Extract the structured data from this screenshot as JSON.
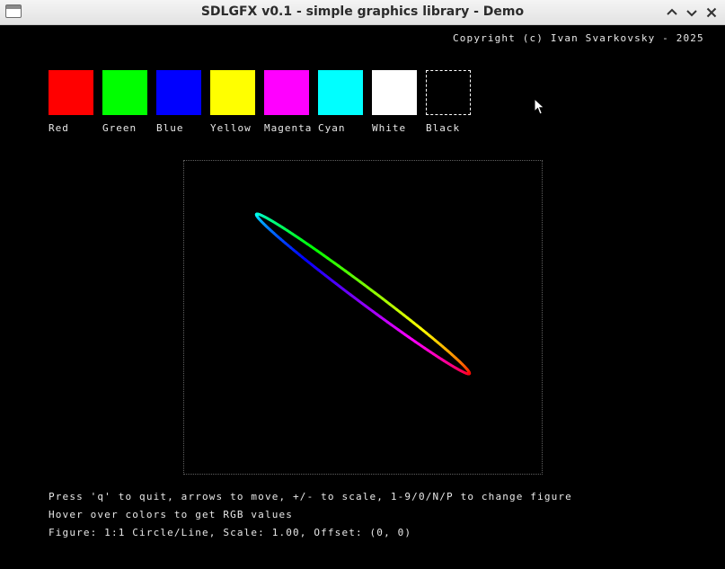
{
  "window": {
    "title": "SDLGFX v0.1 - simple graphics library - Demo",
    "buttons": [
      "minimize-icon",
      "maximize-icon",
      "close-icon"
    ]
  },
  "copyright": "Copyright (c) Ivan Svarkovsky - 2025",
  "palette": [
    {
      "label": "Red",
      "color": "#ff0000"
    },
    {
      "label": "Green",
      "color": "#00ff00"
    },
    {
      "label": "Blue",
      "color": "#0000ff"
    },
    {
      "label": "Yellow",
      "color": "#ffff00"
    },
    {
      "label": "Magenta",
      "color": "#ff00ff"
    },
    {
      "label": "Cyan",
      "color": "#00ffff"
    },
    {
      "label": "White",
      "color": "#ffffff"
    },
    {
      "label": "Black",
      "color": "#000000"
    }
  ],
  "figure": {
    "shape": "ellipse",
    "stroke": "rainbow-gradient"
  },
  "help": {
    "line1": "Press 'q' to quit, arrows to move, +/- to scale, 1-9/0/N/P to change figure",
    "line2": "Hover over colors to get RGB values",
    "line3": "Figure: 1:1 Circle/Line, Scale: 1.00, Offset: (0, 0)"
  }
}
